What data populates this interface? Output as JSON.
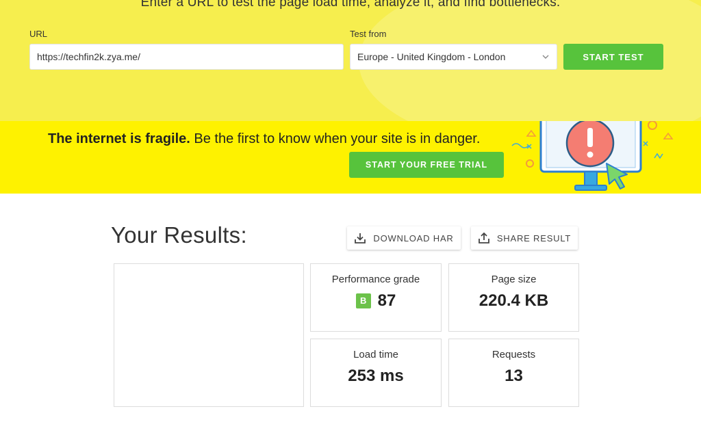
{
  "hero": {
    "tagline": "Enter a URL to test the page load time, analyze it, and find bottlenecks.",
    "url_label": "URL",
    "url_value": "https://techfin2k.zya.me/",
    "test_from_label": "Test from",
    "test_from_value": "Europe - United Kingdom - London",
    "start_test_label": "START TEST"
  },
  "banner": {
    "headline_bold": "The internet is fragile.",
    "headline_rest": " Be the first to know when your site is in danger.",
    "trial_label": "START YOUR FREE TRIAL"
  },
  "results": {
    "title": "Your Results:",
    "download_label": "DOWNLOAD HAR",
    "share_label": "SHARE RESULT",
    "performance": {
      "label": "Performance grade",
      "grade": "B",
      "score": "87"
    },
    "page_size": {
      "label": "Page size",
      "value": "220.4 KB"
    },
    "load_time": {
      "label": "Load time",
      "value": "253 ms"
    },
    "requests": {
      "label": "Requests",
      "value": "13"
    }
  },
  "colors": {
    "hero_bg": "#f6ee4e",
    "banner_bg": "#fef200",
    "accent_green": "#57c33c",
    "grade_green": "#6cc24a"
  },
  "icons": {
    "select_chevron": "chevron-down-icon",
    "download": "download-icon",
    "share": "share-icon",
    "monitor": "alert-monitor-illustration"
  }
}
